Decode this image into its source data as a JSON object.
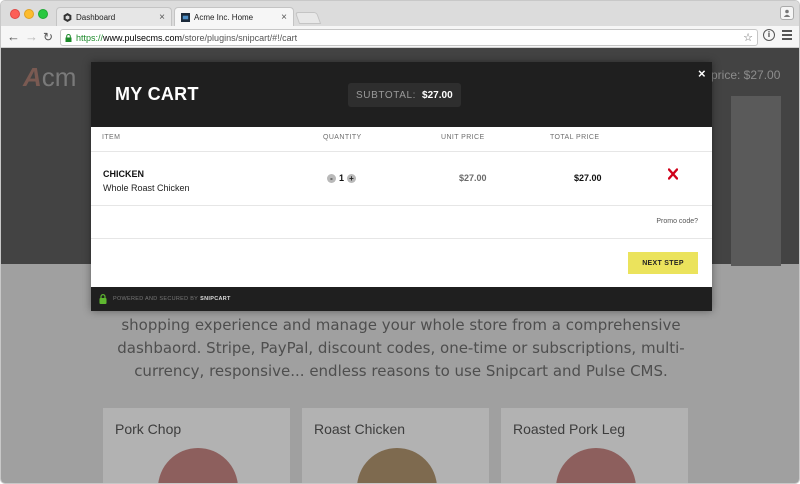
{
  "browser": {
    "tabs": [
      {
        "title": "Dashboard",
        "close": "×",
        "active": false
      },
      {
        "title": "Acme Inc. Home",
        "close": "×",
        "active": true
      }
    ],
    "url": {
      "scheme": "https://",
      "host": "www.pulsecms.com",
      "path": "/store/plugins/snipcart/#!/cart"
    },
    "icons": [
      "back-icon",
      "forward-icon",
      "reload-icon",
      "lock-icon",
      "star-icon",
      "info-icon",
      "menu-icon",
      "user-icon"
    ]
  },
  "page": {
    "logo_letter": "A",
    "logo_rest": "cm",
    "hero_price": "price: $27.00",
    "description": "shopping experience and manage your whole store from a comprehensive dashbaord. Stripe, PayPal, discount codes, one-time or subscriptions, multi-currency, responsive... endless reasons to use Snipcart and Pulse CMS.",
    "products": [
      {
        "name": "Pork Chop"
      },
      {
        "name": "Roast Chicken"
      },
      {
        "name": "Roasted Pork Leg"
      }
    ]
  },
  "cart": {
    "title": "MY CART",
    "subtotal_label": "SUBTOTAL:",
    "subtotal_value": "$27.00",
    "close": "×",
    "columns": {
      "item": "ITEM",
      "quantity": "QUANTITY",
      "unit_price": "UNIT PRICE",
      "total_price": "TOTAL PRICE"
    },
    "items": [
      {
        "name": "CHICKEN",
        "description": "Whole Roast Chicken",
        "minus": "-",
        "quantity": "1",
        "plus": "+",
        "unit_price": "$27.00",
        "total_price": "$27.00"
      }
    ],
    "promo_link": "Promo code?",
    "next_button": "NEXT STEP",
    "footer_text": "POWERED AND SECURED BY",
    "footer_brand": "SNIPCART"
  },
  "colors": {
    "accent": "#ebe35c",
    "remove": "#d0021b",
    "secure": "#5fb830",
    "url_scheme": "#1c8a2a"
  }
}
